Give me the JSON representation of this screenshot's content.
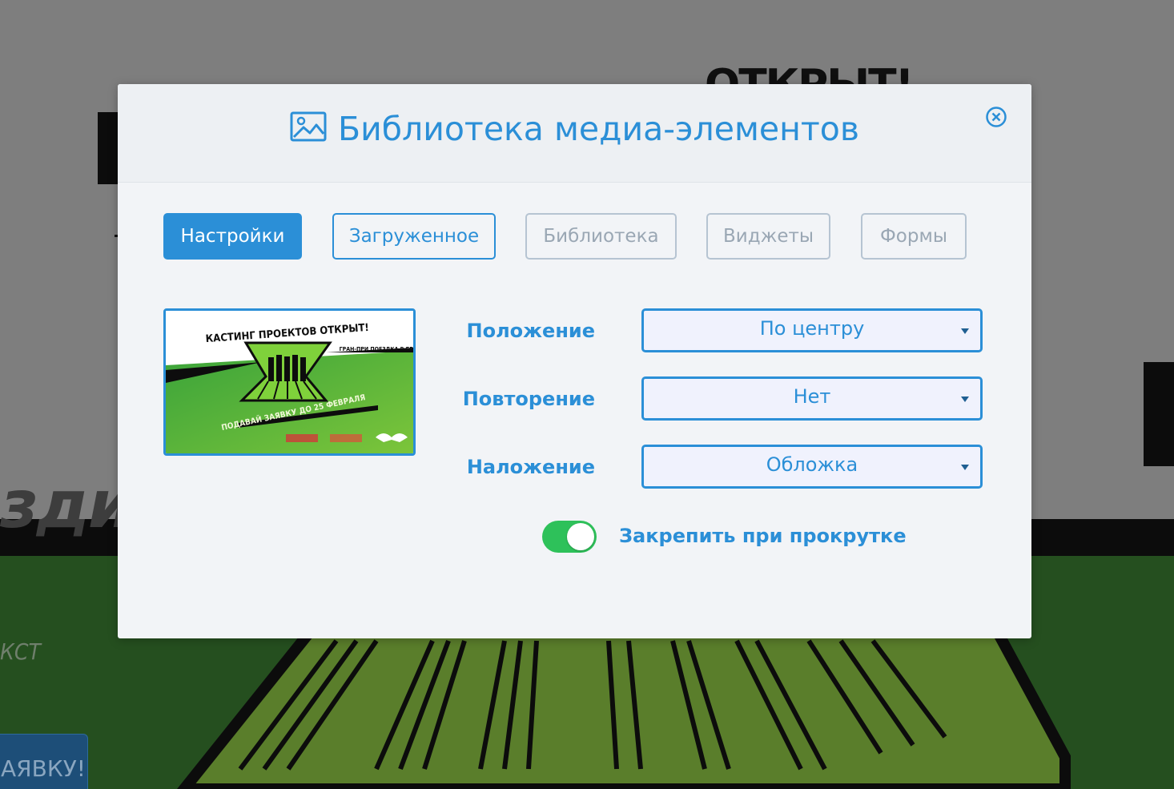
{
  "background": {
    "italic_text": "здит",
    "kst_text": "КСТ",
    "apply_button_label": "АЯВКУ!"
  },
  "modal": {
    "title": "Библиотека медиа-элементов",
    "tabs": [
      {
        "label": "Настройки",
        "state": "active"
      },
      {
        "label": "Загруженное",
        "state": "secondary"
      },
      {
        "label": "Библиотека",
        "state": "inactive"
      },
      {
        "label": "Виджеты",
        "state": "inactive"
      },
      {
        "label": "Формы",
        "state": "inactive"
      }
    ],
    "thumbnail": {
      "icon": "image-preview",
      "headline": "КАСТИНГ ПРОЕКТОВ ОТКРЫТ!",
      "side_text": "ГРАН-ПРИ ПОЕЗДКА В БРЮСЕЛЬ",
      "bottom_text": "ПОДАВАЙ ЗАЯВКУ ДО 25 ФЕВРАЛЯ"
    },
    "fields": [
      {
        "label": "Положение",
        "value": "По центру"
      },
      {
        "label": "Повторение",
        "value": "Нет"
      },
      {
        "label": "Наложение",
        "value": "Обложка"
      }
    ],
    "pin_toggle": {
      "label": "Закрепить при прокрутке",
      "on": true
    },
    "icons": {
      "title": "image-icon",
      "close": "close-circle-icon",
      "select": "caret-down-icon"
    }
  },
  "colors": {
    "accent": "#2b8fd7",
    "toggle_on": "#2ec15a",
    "overlay": "#7b7b7b"
  }
}
